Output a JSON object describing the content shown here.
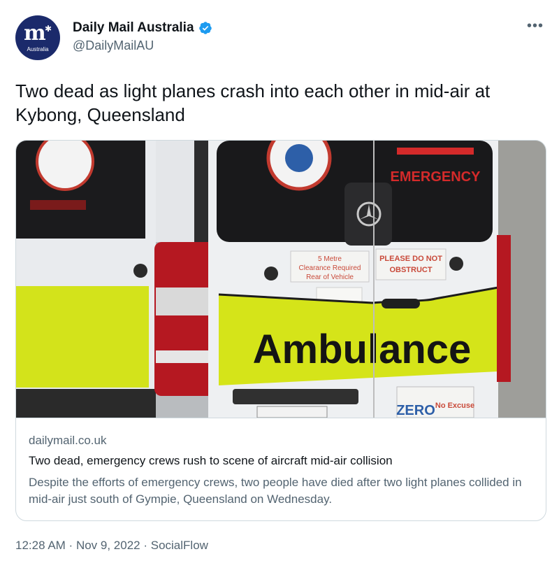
{
  "account": {
    "display_name": "Daily Mail Australia",
    "handle": "@DailyMailAU",
    "avatar_label": "Australia",
    "verified_icon": "verified-badge-icon",
    "brand_color": "#1b2a6b"
  },
  "tweet": {
    "text": "Two dead as light planes crash into each other in mid-air at Kybong, Queensland"
  },
  "card": {
    "domain": "dailymail.co.uk",
    "title": "Two dead, emergency crews rush to scene of aircraft mid-air collision",
    "description": "Despite the efforts of emergency crews, two people have died after two light planes collided in mid-air just south of Gympie, Queensland on Wednesday.",
    "image_text": {
      "emergency": "EMERGENCY",
      "ambulance": "Ambulance",
      "clearance": [
        "5 Metre",
        "Clearance Required",
        "Rear of Vehicle"
      ],
      "obstruct": [
        "PLEASE DO NOT",
        "OBSTRUCT"
      ],
      "zero": "ZERO",
      "no_excuse": "No Excuse"
    }
  },
  "meta": {
    "time": "12:28 AM",
    "date": "Nov 9, 2022",
    "source": "SocialFlow"
  }
}
